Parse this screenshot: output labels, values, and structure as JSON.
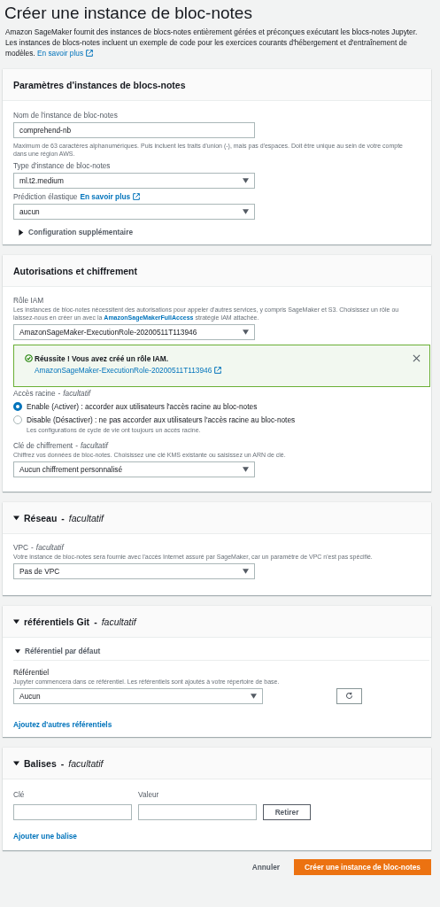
{
  "page": {
    "title": "Créer une instance de bloc-notes",
    "intro": "Amazon SageMaker fournit des instances de blocs-notes entièrement gérées et préconçues exécutant les blocs-notes Jupyter. Les instances de blocs-notes incluent un exemple de code pour les exercices courants d'hébergement et d'entraînement de modèles.",
    "intro_link": "En savoir plus"
  },
  "settings": {
    "title": "Paramètres d'instances de blocs-notes",
    "name_field": {
      "label": "Nom de l'instance de bloc-notes",
      "value": "comprehend-nb",
      "hint": "Maximum de 63 caractères alphanumériques. Puis incluent les traits d'union (-), mais pas d'espaces. Doit être unique au sein de votre compte dans une région AWS."
    },
    "type_field": {
      "label": "Type d'instance de bloc-notes",
      "value": "ml.t2.medium"
    },
    "elastic_field": {
      "label": "Prédiction élastique",
      "link": "En savoir plus",
      "value": "aucun"
    },
    "extra_config": {
      "label": "Configuration supplémentaire",
      "expanded": false
    }
  },
  "permissions": {
    "title": "Autorisations et chiffrement",
    "role": {
      "label": "Rôle IAM",
      "hint_before": "Les instances de bloc-notes nécessitent des autorisations pour appeler d'autres services, y compris SageMaker et S3. Choisissez un rôle ou laissez-nous en créer un avec la",
      "hint_link": "AmazonSageMakerFullAccess",
      "hint_after": "stratégie IAM attachée.",
      "value": "AmazonSageMaker-ExecutionRole-20200511T113946"
    },
    "alert": {
      "title": "Réussite ! Vous avez créé un rôle IAM.",
      "link": "AmazonSageMaker-ExecutionRole-20200511T113946"
    },
    "root_access": {
      "label": "Accès racine",
      "separator": "-",
      "optional": "facultatif",
      "options": [
        {
          "label": "Enable (Activer) : accorder aux utilisateurs l'accès racine au bloc-notes",
          "selected": true
        },
        {
          "label": "Disable (Désactiver) : ne pas accorder aux utilisateurs l'accès racine au bloc-notes",
          "selected": false,
          "note": "Les configurations de cycle de vie ont toujours un accès racine."
        }
      ]
    },
    "encryption": {
      "label": "Clé de chiffrement",
      "separator": "-",
      "optional": "facultatif",
      "hint": "Chiffrez vos données de bloc-notes. Choisissez une clé KMS existante ou saisissez un ARN de clé.",
      "value": "Aucun chiffrement personnalisé"
    }
  },
  "network": {
    "title": "Réseau",
    "separator": "-",
    "optional": "facultatif",
    "expanded": true,
    "vpc": {
      "label": "VPC",
      "separator": "-",
      "optional": "facultatif",
      "hint": "Votre instance de bloc-notes sera fournie avec l'accès Internet assuré par SageMaker, car un paramètre de VPC n'est pas spécifié.",
      "value": "Pas de VPC"
    }
  },
  "git": {
    "title": "référentiels Git",
    "separator": "-",
    "optional": "facultatif",
    "expanded": true,
    "default_repo": {
      "label": "Référentiel par défaut",
      "expanded": true
    },
    "repo": {
      "label": "Référentiel",
      "hint": "Jupyter commencera dans ce référentiel. Les référentiels sont ajoutés à votre répertoire de base.",
      "value": "Aucun"
    },
    "add_link": "Ajoutez d'autres référentiels"
  },
  "tags": {
    "title": "Balises",
    "separator": "-",
    "optional": "facultatif",
    "expanded": true,
    "key_label": "Clé",
    "value_label": "Valeur",
    "remove_button": "Retirer",
    "add_link": "Ajouter une balise"
  },
  "footer": {
    "cancel": "Annuler",
    "submit": "Créer une instance de bloc-notes"
  }
}
